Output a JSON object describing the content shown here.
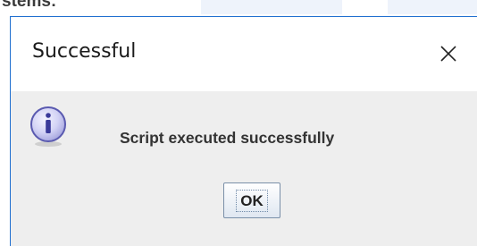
{
  "background": {
    "partial_text": "stems:"
  },
  "dialog": {
    "title": "Successful",
    "message": "Script executed successfully",
    "icon": "info-icon",
    "close_icon": "close-icon",
    "ok_label": "OK"
  },
  "colors": {
    "window_border": "#1f6fd0",
    "titlebar_bg": "#ffffff",
    "body_bg": "#eeeeee",
    "icon_fill": "#c9c9f0",
    "icon_stroke": "#5a5ab0"
  }
}
